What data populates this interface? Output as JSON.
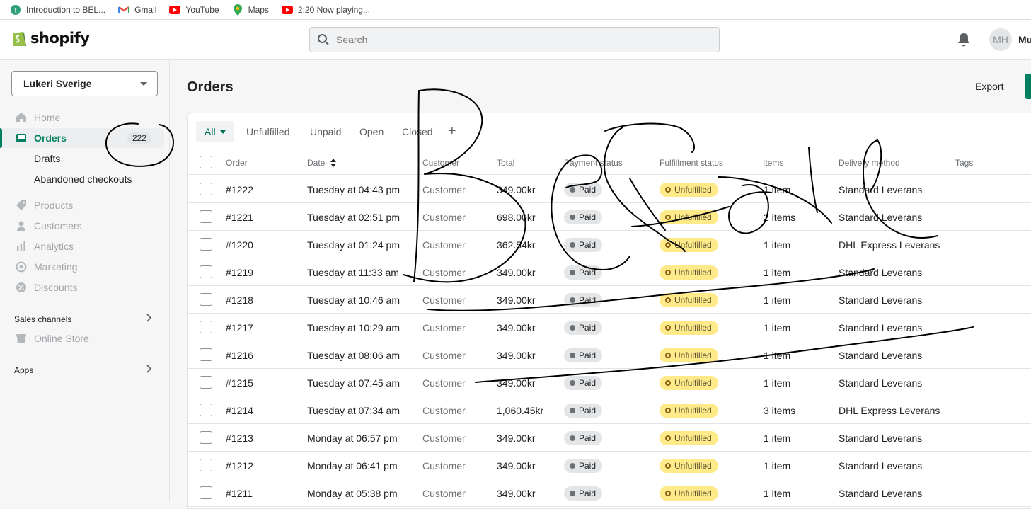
{
  "bookmarks": [
    {
      "label": "Introduction to BEL...",
      "icon": "t-circle-icon"
    },
    {
      "label": "Gmail",
      "icon": "gmail-icon"
    },
    {
      "label": "YouTube",
      "icon": "youtube-icon"
    },
    {
      "label": "Maps",
      "icon": "maps-pin-icon"
    },
    {
      "label": "2:20 Now playing...",
      "icon": "youtube-icon"
    }
  ],
  "topbar": {
    "logo_text": "shopify",
    "search_placeholder": "Search",
    "avatar_initials": "MH",
    "username": "Mu"
  },
  "sidebar": {
    "store_name": "Lukeri Sverige",
    "nav": [
      {
        "label": "Home",
        "icon": "home-icon"
      },
      {
        "label": "Orders",
        "icon": "orders-icon",
        "badge": "222"
      },
      {
        "label": "Drafts"
      },
      {
        "label": "Abandoned checkouts"
      },
      {
        "label": "Products",
        "icon": "tag-icon"
      },
      {
        "label": "Customers",
        "icon": "person-icon"
      },
      {
        "label": "Analytics",
        "icon": "bar-chart-icon"
      },
      {
        "label": "Marketing",
        "icon": "target-icon"
      },
      {
        "label": "Discounts",
        "icon": "discount-icon"
      }
    ],
    "sales_channels_label": "Sales channels",
    "online_store_label": "Online Store",
    "apps_label": "Apps"
  },
  "main": {
    "title": "Orders",
    "export_label": "Export",
    "tabs": [
      "All",
      "Unfulfilled",
      "Unpaid",
      "Open",
      "Closed"
    ],
    "columns": [
      "Order",
      "Date",
      "Customer",
      "Total",
      "Payment status",
      "Fulfillment status",
      "Items",
      "Delivery method",
      "Tags"
    ],
    "rows": [
      {
        "order": "#1222",
        "date": "Tuesday at 04:43 pm",
        "customer": "Customer",
        "total": "349.00kr",
        "payment": "Paid",
        "fulfillment": "Unfulfilled",
        "items": "1 item",
        "delivery": "Standard Leverans"
      },
      {
        "order": "#1221",
        "date": "Tuesday at 02:51 pm",
        "customer": "Customer",
        "total": "698.00kr",
        "payment": "Paid",
        "fulfillment": "Unfulfilled",
        "items": "2 items",
        "delivery": "Standard Leverans"
      },
      {
        "order": "#1220",
        "date": "Tuesday at 01:24 pm",
        "customer": "Customer",
        "total": "362.54kr",
        "payment": "Paid",
        "fulfillment": "Unfulfilled",
        "items": "1 item",
        "delivery": "DHL Express Leverans"
      },
      {
        "order": "#1219",
        "date": "Tuesday at 11:33 am",
        "customer": "Customer",
        "total": "349.00kr",
        "payment": "Paid",
        "fulfillment": "Unfulfilled",
        "items": "1 item",
        "delivery": "Standard Leverans"
      },
      {
        "order": "#1218",
        "date": "Tuesday at 10:46 am",
        "customer": "Customer",
        "total": "349.00kr",
        "payment": "Paid",
        "fulfillment": "Unfulfilled",
        "items": "1 item",
        "delivery": "Standard Leverans"
      },
      {
        "order": "#1217",
        "date": "Tuesday at 10:29 am",
        "customer": "Customer",
        "total": "349.00kr",
        "payment": "Paid",
        "fulfillment": "Unfulfilled",
        "items": "1 item",
        "delivery": "Standard Leverans"
      },
      {
        "order": "#1216",
        "date": "Tuesday at 08:06 am",
        "customer": "Customer",
        "total": "349.00kr",
        "payment": "Paid",
        "fulfillment": "Unfulfilled",
        "items": "1 item",
        "delivery": "Standard Leverans"
      },
      {
        "order": "#1215",
        "date": "Tuesday at 07:45 am",
        "customer": "Customer",
        "total": "349.00kr",
        "payment": "Paid",
        "fulfillment": "Unfulfilled",
        "items": "1 item",
        "delivery": "Standard Leverans"
      },
      {
        "order": "#1214",
        "date": "Tuesday at 07:34 am",
        "customer": "Customer",
        "total": "1,060.45kr",
        "payment": "Paid",
        "fulfillment": "Unfulfilled",
        "items": "3 items",
        "delivery": "DHL Express Leverans"
      },
      {
        "order": "#1213",
        "date": "Monday at 06:57 pm",
        "customer": "Customer",
        "total": "349.00kr",
        "payment": "Paid",
        "fulfillment": "Unfulfilled",
        "items": "1 item",
        "delivery": "Standard Leverans"
      },
      {
        "order": "#1212",
        "date": "Monday at 06:41 pm",
        "customer": "Customer",
        "total": "349.00kr",
        "payment": "Paid",
        "fulfillment": "Unfulfilled",
        "items": "1 item",
        "delivery": "Standard Leverans"
      },
      {
        "order": "#1211",
        "date": "Monday at 05:38 pm",
        "customer": "Customer",
        "total": "349.00kr",
        "payment": "Paid",
        "fulfillment": "Unfulfilled",
        "items": "1 item",
        "delivery": "Standard Leverans"
      }
    ]
  },
  "colors": {
    "accent": "#008060",
    "paid_badge": "#e4e5e7",
    "unfulfilled_badge": "#ffea8a",
    "annotation_ink": "#000000"
  }
}
